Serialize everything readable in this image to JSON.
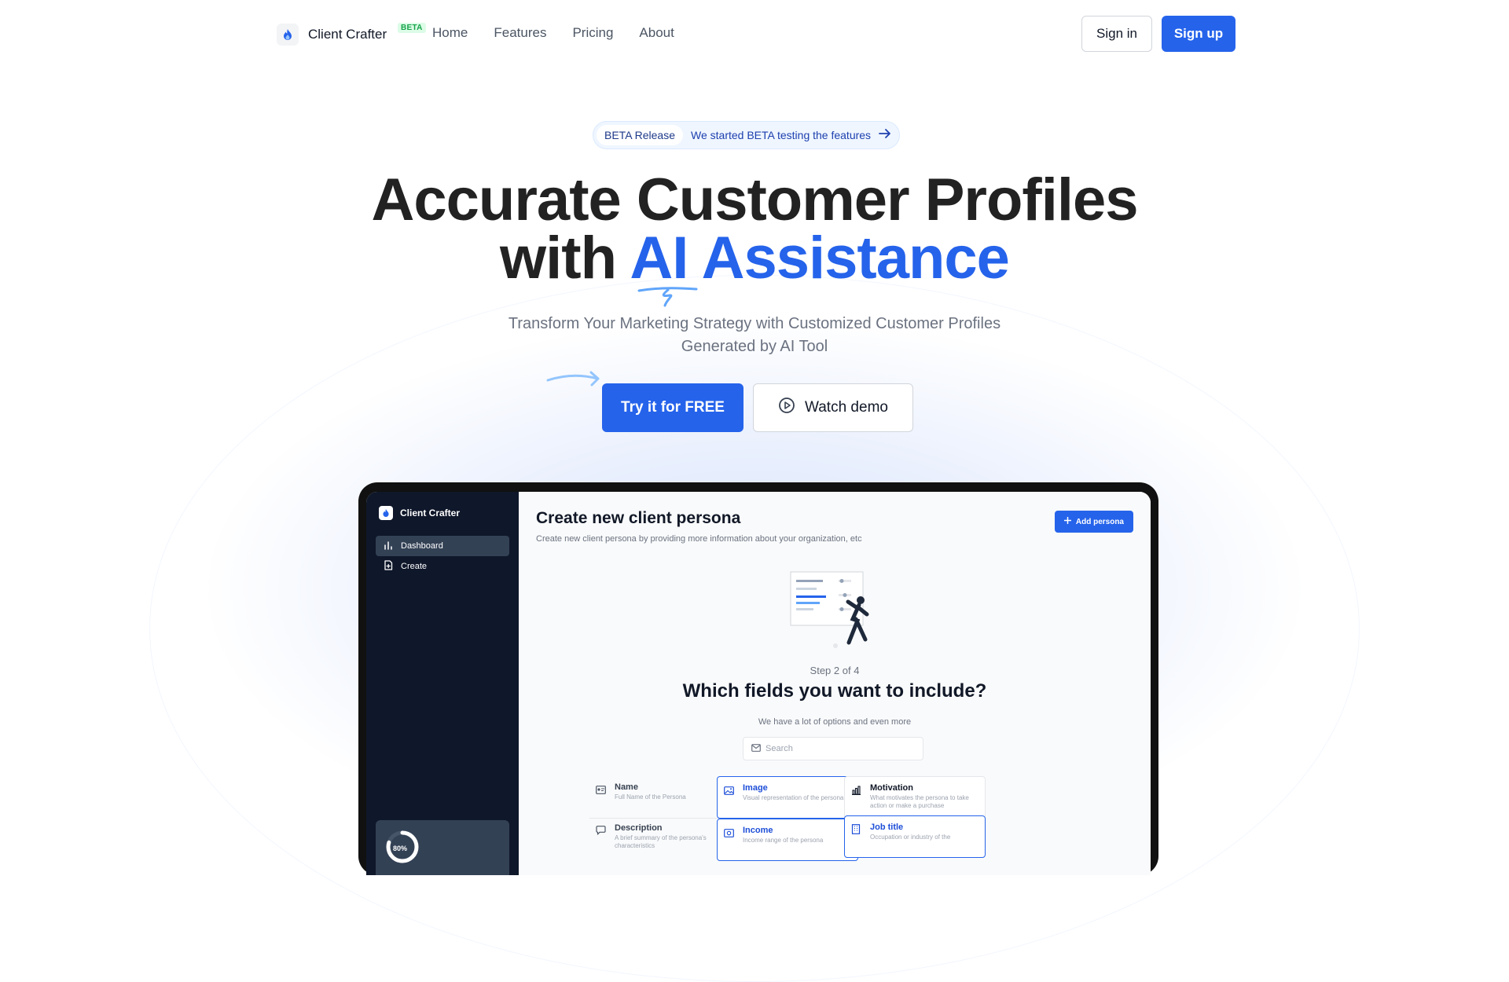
{
  "nav": {
    "brand_name": "Client Crafter",
    "beta_badge": "BETA",
    "links": [
      "Home",
      "Features",
      "Pricing",
      "About"
    ],
    "sign_in": "Sign in",
    "sign_up": "Sign up"
  },
  "hero": {
    "announce_tag": "BETA Release",
    "announce_text": "We started BETA testing the features",
    "headline_line1": "Accurate Customer Profiles",
    "headline_prefix": "with ",
    "headline_accent": "AI Assistance",
    "subtitle_line1": "Transform Your Marketing Strategy with Customized Customer Profiles",
    "subtitle_line2": "Generated by AI Tool",
    "cta_primary": "Try it for FREE",
    "cta_secondary": "Watch demo"
  },
  "app": {
    "brand_name": "Client Crafter",
    "sidebar_items": [
      "Dashboard",
      "Create"
    ],
    "progress_label": "80%",
    "progress_value": 0.8,
    "title": "Create new client persona",
    "description": "Create new client persona by providing more information about your organization, etc",
    "add_button": "Add persona",
    "step": "Step 2 of 4",
    "question": "Which fields you want to include?",
    "hint": "We have a lot of options and even more",
    "search_placeholder": "Search",
    "fields": [
      {
        "name": "Name",
        "desc": "Full Name of the Persona",
        "state": "plain",
        "icon": "id-card-icon"
      },
      {
        "name": "Image",
        "desc": "Visual representation of the persona",
        "state": "selected",
        "icon": "image-icon"
      },
      {
        "name": "Motivation",
        "desc": "What motivates the persona to take action or make a purchase",
        "state": "box",
        "icon": "chart-icon"
      },
      {
        "name": "Description",
        "desc": "A brief summary of the persona's characteristics",
        "state": "plain",
        "icon": "chat-icon"
      },
      {
        "name": "Income",
        "desc": "Income range of the persona",
        "state": "selected",
        "icon": "money-icon"
      },
      {
        "name": "Job title",
        "desc": "Occupation or industry of the",
        "state": "selected",
        "icon": "building-icon"
      }
    ]
  },
  "colors": {
    "accent": "#2563eb",
    "sidebar": "#0f172a",
    "beta_badge_bg": "#dcfce7",
    "beta_badge_fg": "#16a34a"
  }
}
